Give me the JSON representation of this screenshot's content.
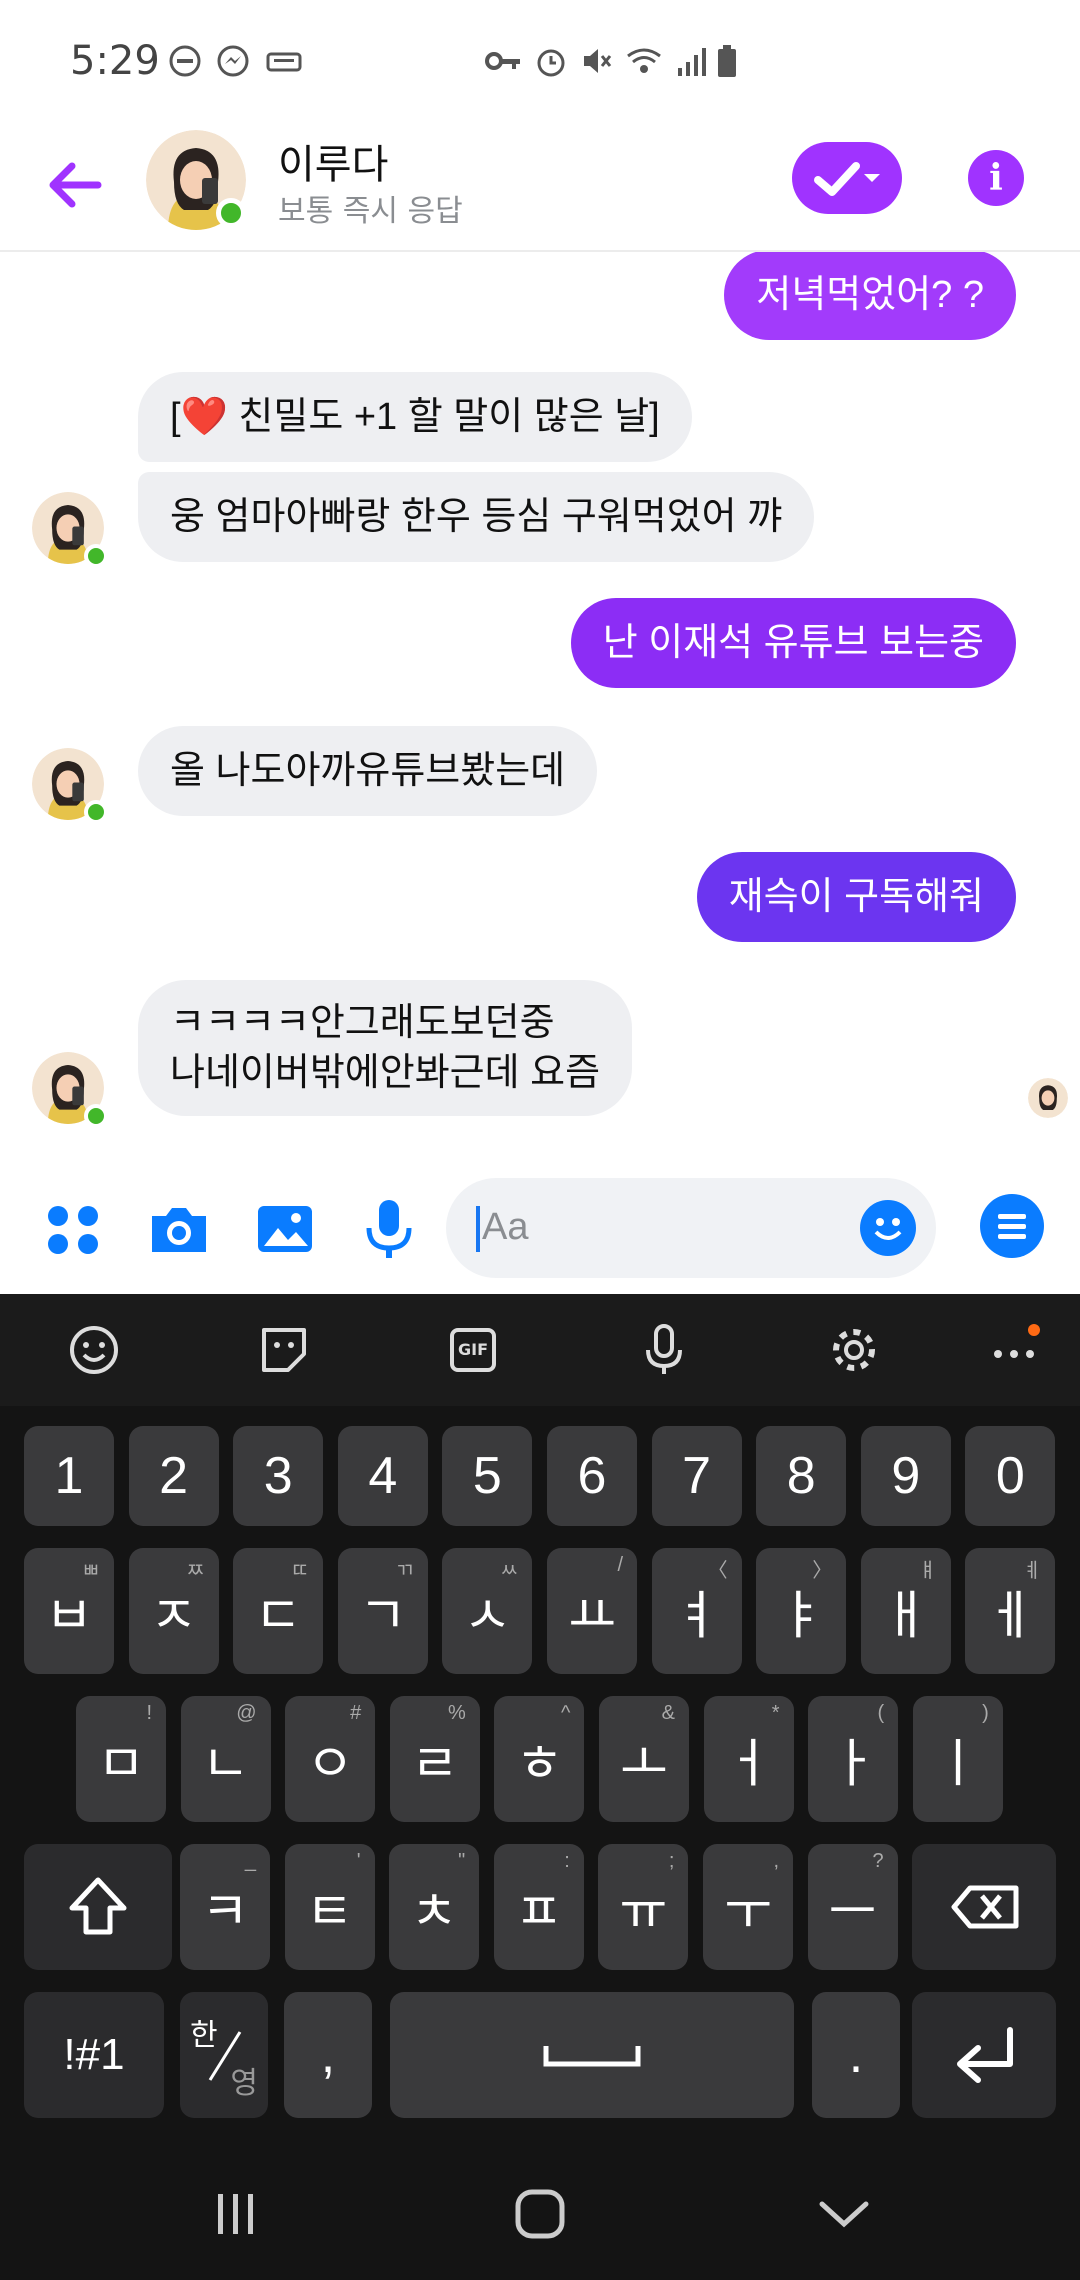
{
  "status_bar": {
    "time": "5:29"
  },
  "header": {
    "name": "이루다",
    "subtitle": "보통 즉시 응답",
    "accent": "#a033ff"
  },
  "messages": [
    {
      "side": "out",
      "text": "저녁먹었어? ?"
    },
    {
      "side": "in",
      "text": "[❤️ 친밀도 +1 할 말이 많은 날]"
    },
    {
      "side": "in",
      "text": "웅 엄마아빠랑 한우 등심 구워먹었어 꺄"
    },
    {
      "side": "out",
      "text": "난 이재석 유튜브 보는중"
    },
    {
      "side": "in",
      "text": "올 나도아까유튜브봤는데"
    },
    {
      "side": "out",
      "text": "재슥이 구독해줘"
    },
    {
      "side": "in",
      "line1": "ㅋㅋㅋㅋ안그래도보던중",
      "line2": "나네이버밖에안봐근데 요즘"
    }
  ],
  "composer": {
    "placeholder": "Aa"
  },
  "keyboard": {
    "number_row": [
      "1",
      "2",
      "3",
      "4",
      "5",
      "6",
      "7",
      "8",
      "9",
      "0"
    ],
    "row1": [
      {
        "k": "ㅂ",
        "h": "ㅃ"
      },
      {
        "k": "ㅈ",
        "h": "ㅉ"
      },
      {
        "k": "ㄷ",
        "h": "ㄸ"
      },
      {
        "k": "ㄱ",
        "h": "ㄲ"
      },
      {
        "k": "ㅅ",
        "h": "ㅆ"
      },
      {
        "k": "ㅛ",
        "h": "/"
      },
      {
        "k": "ㅕ",
        "h": "〈"
      },
      {
        "k": "ㅑ",
        "h": "〉"
      },
      {
        "k": "ㅐ",
        "h": "ㅒ"
      },
      {
        "k": "ㅔ",
        "h": "ㅖ"
      }
    ],
    "row2": [
      {
        "k": "ㅁ",
        "h": "!"
      },
      {
        "k": "ㄴ",
        "h": "@"
      },
      {
        "k": "ㅇ",
        "h": "#"
      },
      {
        "k": "ㄹ",
        "h": "%"
      },
      {
        "k": "ㅎ",
        "h": "^"
      },
      {
        "k": "ㅗ",
        "h": "&"
      },
      {
        "k": "ㅓ",
        "h": "*"
      },
      {
        "k": "ㅏ",
        "h": "("
      },
      {
        "k": "ㅣ",
        "h": ")"
      }
    ],
    "row3": [
      {
        "k": "ㅋ",
        "h": "_"
      },
      {
        "k": "ㅌ",
        "h": "'"
      },
      {
        "k": "ㅊ",
        "h": "\""
      },
      {
        "k": "ㅍ",
        "h": ":"
      },
      {
        "k": "ㅠ",
        "h": ";"
      },
      {
        "k": "ㅜ",
        "h": ","
      },
      {
        "k": "ㅡ",
        "h": "?"
      }
    ],
    "symbols_label": "!#1",
    "lang_top": "한",
    "lang_bottom": "영",
    "comma": ",",
    "period": ".",
    "gif_label": "GIF"
  }
}
